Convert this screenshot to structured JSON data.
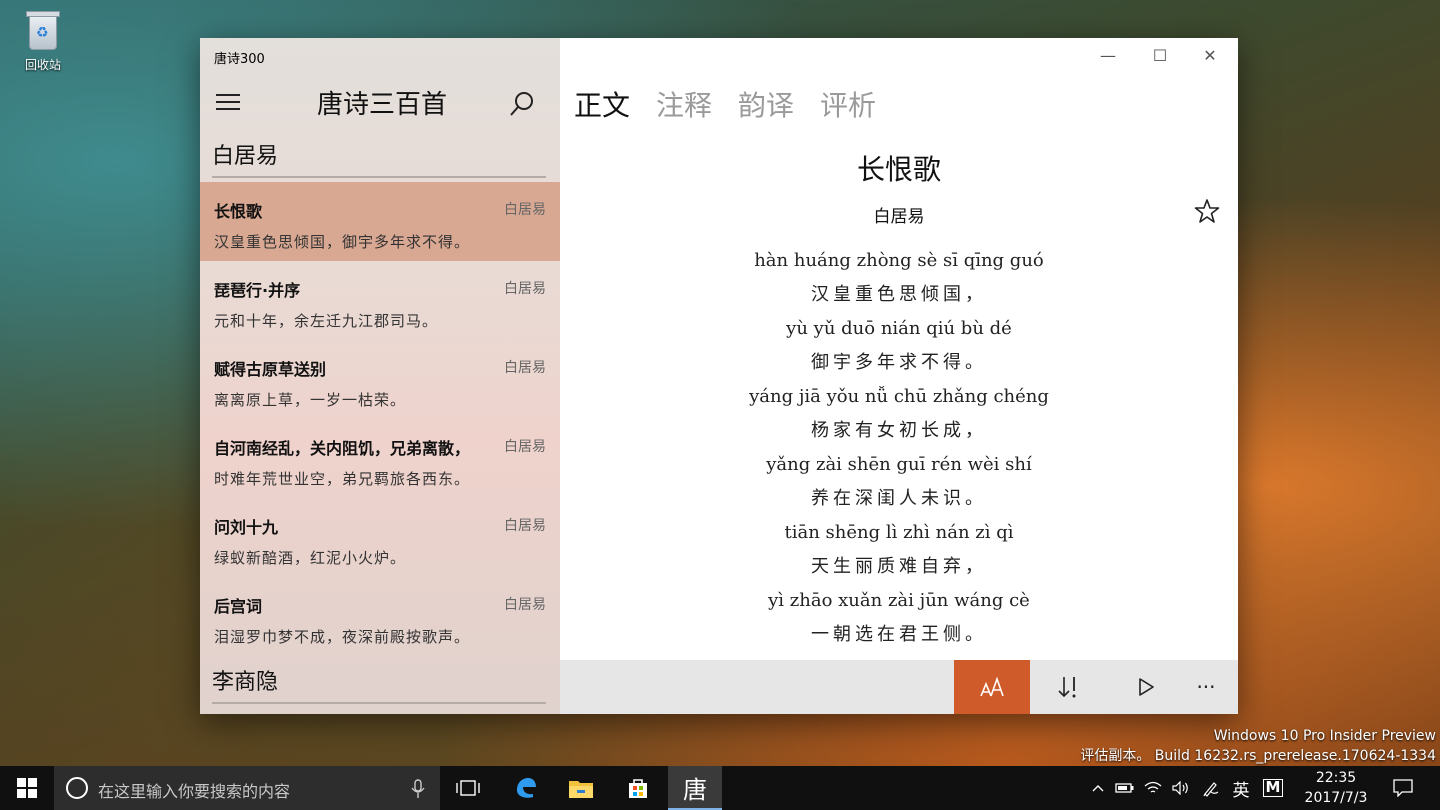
{
  "desktop": {
    "recycle_bin_label": "回收站"
  },
  "app": {
    "window_title": "唐诗300",
    "pane_title": "唐诗三百首",
    "sections": [
      "白居易",
      "李商隐"
    ],
    "poems": [
      {
        "title": "长恨歌",
        "author": "白居易",
        "first_line": "汉皇重色思倾国，御宇多年求不得。"
      },
      {
        "title": "琵琶行·并序",
        "author": "白居易",
        "first_line": "元和十年，余左迁九江郡司马。"
      },
      {
        "title": "赋得古原草送别",
        "author": "白居易",
        "first_line": "离离原上草，一岁一枯荣。"
      },
      {
        "title": "自河南经乱，关内阻饥，兄弟离散，",
        "author": "白居易",
        "first_line": "时难年荒世业空，弟兄羁旅各西东。"
      },
      {
        "title": "问刘十九",
        "author": "白居易",
        "first_line": "绿蚁新醅酒，红泥小火炉。"
      },
      {
        "title": "后宫词",
        "author": "白居易",
        "first_line": "泪湿罗巾梦不成，夜深前殿按歌声。"
      }
    ],
    "window_controls": {
      "minimize": "—",
      "maximize": "☐",
      "close": "✕"
    },
    "tabs": [
      "正文",
      "注释",
      "韵译",
      "评析"
    ],
    "poem": {
      "title": "长恨歌",
      "author": "白居易",
      "verses": [
        {
          "pinyin": "hàn huáng zhòng sè sī qīng guó",
          "han": "汉皇重色思倾国，"
        },
        {
          "pinyin": "yù yǔ duō nián qiú bù dé",
          "han": "御宇多年求不得。"
        },
        {
          "pinyin": "yáng jiā yǒu nǚ chū zhǎng chéng",
          "han": "杨家有女初长成，"
        },
        {
          "pinyin": "yǎng zài shēn guī rén wèi shí",
          "han": "养在深闺人未识。"
        },
        {
          "pinyin": "tiān shēng lì zhì nán zì qì",
          "han": "天生丽质难自弃，"
        },
        {
          "pinyin": "yì zhāo xuǎn zài jūn wáng cè",
          "han": "一朝选在君王侧。"
        }
      ]
    },
    "toolbar": {
      "font_size_icon": "font-size-icon",
      "sort_icon": "sort-icon",
      "play_icon": "play-icon",
      "more_label": "···"
    },
    "accent_color": "#d05b2a",
    "selected_row_color": "#d9a892"
  },
  "watermark": {
    "line1": "Windows 10 Pro Insider Preview",
    "line2": "评估副本。 Build 16232.rs_prerelease.170624-1334"
  },
  "taskbar": {
    "search_placeholder": "在这里输入你要搜索的内容",
    "running_app_glyph": "唐",
    "ime_label": "英",
    "ime_mode": "M",
    "time": "22:35",
    "date": "2017/7/3"
  }
}
